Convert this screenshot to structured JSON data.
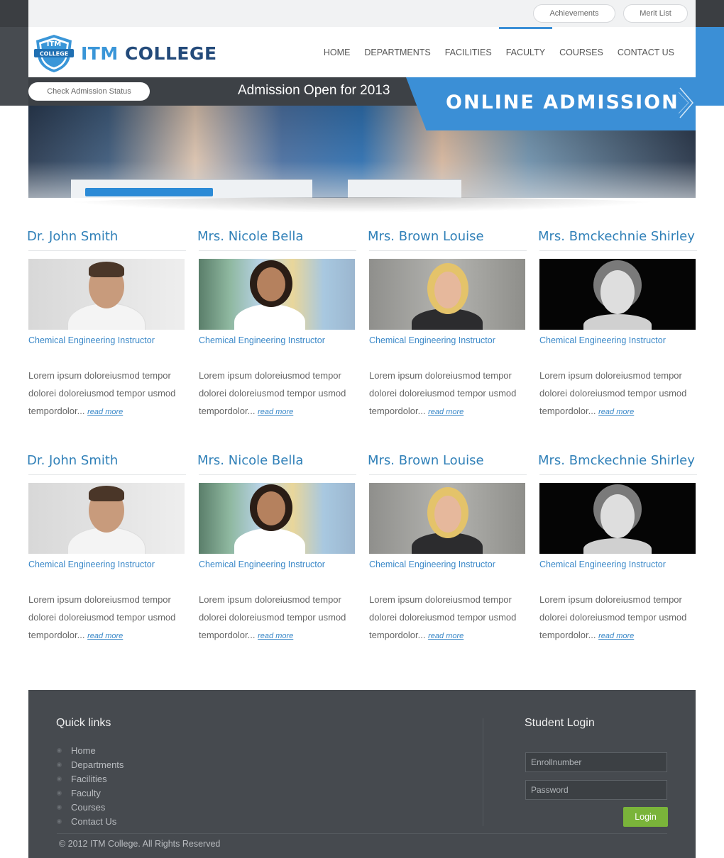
{
  "topbar": {
    "achievements_label": "Achievements",
    "merit_list_label": "Merit List"
  },
  "logo": {
    "badge_top": "ITM",
    "badge_ribbon": "COLLEGE",
    "name_part1": "ITM",
    "name_part2": "COLLEGE",
    "icon": "shield-badge-icon",
    "colors": {
      "primary": "#3a96d8",
      "dark": "#234a7a"
    }
  },
  "nav": {
    "items": [
      {
        "label": "HOME"
      },
      {
        "label": "DEPARTMENTS"
      },
      {
        "label": "FACILITIES"
      },
      {
        "label": "FACULTY",
        "active": true
      },
      {
        "label": "COURSES"
      },
      {
        "label": "CONTACT US"
      }
    ]
  },
  "admission": {
    "status_button": "Check Admission Status",
    "open_text": "Admission Open for 2013",
    "online_label": "ONLINE ADMISSION",
    "arrow_icon": "chevron-right-icon"
  },
  "faculty": {
    "rows": [
      [
        {
          "name": "Dr. John Smith",
          "role": "Chemical Engineering Instructor",
          "desc": "Lorem ipsum doloreiusmod tempor dolorei doloreiusmod tempor usmod tempordolor...",
          "read_more": "read more"
        },
        {
          "name": "Mrs. Nicole Bella",
          "role": "Chemical Engineering Instructor",
          "desc": "Lorem ipsum doloreiusmod tempor dolorei doloreiusmod tempor usmod tempordolor...",
          "read_more": "read more"
        },
        {
          "name": "Mrs. Brown Louise",
          "role": "Chemical Engineering Instructor",
          "desc": "Lorem ipsum doloreiusmod tempor dolorei doloreiusmod tempor usmod tempordolor...",
          "read_more": "read more"
        },
        {
          "name": "Mrs. Bmckechnie Shirley",
          "role": "Chemical Engineering Instructor",
          "desc": "Lorem ipsum doloreiusmod tempor dolorei doloreiusmod tempor usmod tempordolor...",
          "read_more": "read more"
        }
      ],
      [
        {
          "name": "Dr. John Smith",
          "role": "Chemical Engineering Instructor",
          "desc": "Lorem ipsum doloreiusmod tempor dolorei doloreiusmod tempor usmod tempordolor...",
          "read_more": "read more"
        },
        {
          "name": "Mrs. Nicole Bella",
          "role": "Chemical Engineering Instructor",
          "desc": "Lorem ipsum doloreiusmod tempor dolorei doloreiusmod tempor usmod tempordolor...",
          "read_more": "read more"
        },
        {
          "name": "Mrs. Brown Louise",
          "role": "Chemical Engineering Instructor",
          "desc": "Lorem ipsum doloreiusmod tempor dolorei doloreiusmod tempor usmod tempordolor...",
          "read_more": "read more"
        },
        {
          "name": "Mrs. Bmckechnie Shirley",
          "role": "Chemical Engineering Instructor",
          "desc": "Lorem ipsum doloreiusmod tempor dolorei doloreiusmod tempor usmod tempordolor...",
          "read_more": "read more"
        }
      ]
    ]
  },
  "footer": {
    "quick_links_title": "Quick links",
    "links": [
      "Home",
      "Departments",
      "Facilities",
      "Faculty",
      "Courses",
      "Contact Us"
    ],
    "login_title": "Student Login",
    "enroll_placeholder": "Enrollnumber",
    "password_placeholder": "Password",
    "login_button": "Login",
    "copyright": "© 2012 ITM College. All Rights Reserved"
  },
  "colors": {
    "accent_blue": "#3b8fd6",
    "dark_gray": "#464a4f",
    "login_green": "#7ab43a"
  }
}
